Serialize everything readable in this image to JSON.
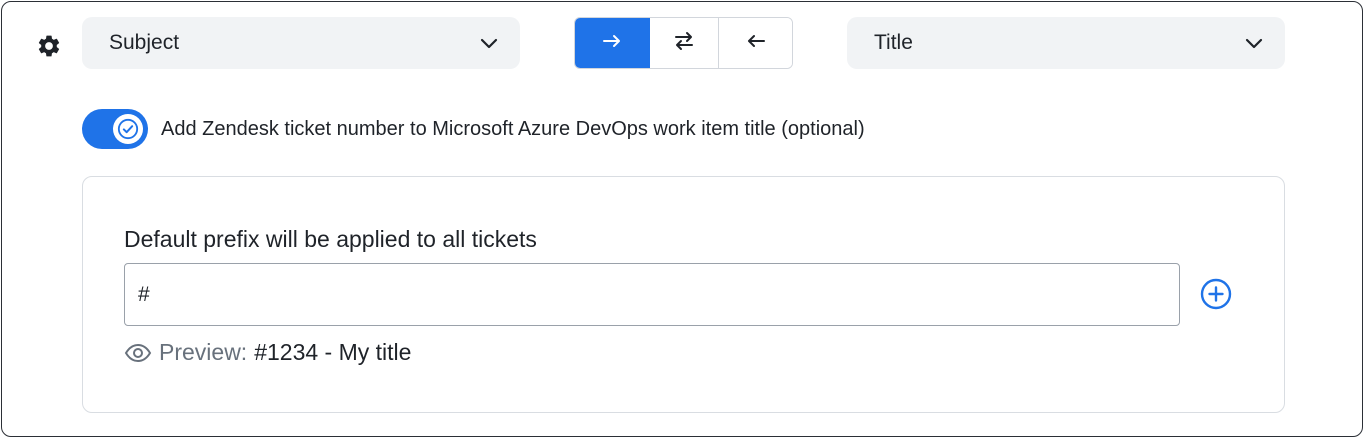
{
  "mapping": {
    "source_field": "Subject",
    "target_field": "Title",
    "directions": [
      {
        "icon": "arrow-right-icon",
        "active": true
      },
      {
        "icon": "swap-arrows-icon",
        "active": false
      },
      {
        "icon": "arrow-left-icon",
        "active": false
      }
    ]
  },
  "toggle": {
    "checked": true,
    "label": "Add Zendesk ticket number to Microsoft Azure DevOps work item title (optional)"
  },
  "prefix": {
    "heading": "Default prefix will be applied to all tickets",
    "value": "#",
    "preview_label": "Preview:",
    "preview_value": "#1234 - My title"
  },
  "colors": {
    "accent": "#1f73e8",
    "muted": "#68717c",
    "field_bg": "#f1f3f5"
  }
}
